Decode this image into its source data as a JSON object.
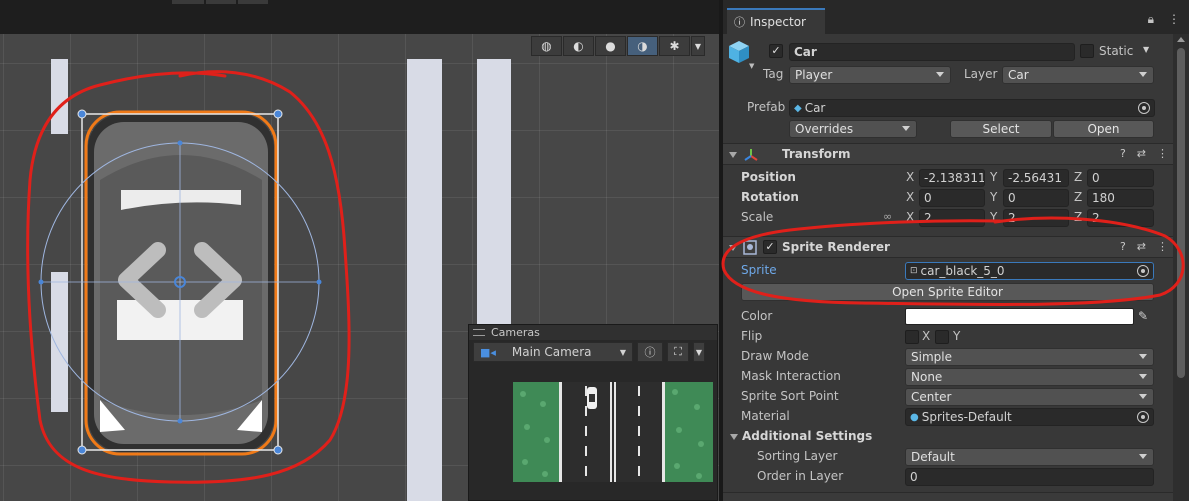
{
  "scene": {
    "draw_tools": [
      {
        "icon": "wireframe-globe-icon",
        "glyph": "◍"
      },
      {
        "icon": "shaded-wireframe-icon",
        "glyph": "◐"
      },
      {
        "icon": "shaded-sphere-icon",
        "glyph": "●"
      },
      {
        "icon": "unlit-moon-icon",
        "glyph": "◑"
      },
      {
        "icon": "debug-bug-icon",
        "glyph": "✱"
      }
    ]
  },
  "cameras": {
    "title": "Cameras",
    "selected": "Main Camera"
  },
  "inspector": {
    "tab_label": "Inspector",
    "object": {
      "name": "Car",
      "active": "✓",
      "static_label": "Static",
      "tag_label": "Tag",
      "tag_value": "Player",
      "layer_label": "Layer",
      "layer_value": "Car",
      "prefab_label": "Prefab",
      "prefab_value": "Car",
      "overrides_label": "Overrides",
      "select_label": "Select",
      "open_label": "Open"
    },
    "transform": {
      "title": "Transform",
      "position_label": "Position",
      "rotation_label": "Rotation",
      "scale_label": "Scale",
      "axis_x": "X",
      "axis_y": "Y",
      "axis_z": "Z",
      "position": {
        "x": "-2.138311",
        "y": "-2.56431",
        "z": "0"
      },
      "rotation": {
        "x": "0",
        "y": "0",
        "z": "180"
      },
      "scale": {
        "x": "2",
        "y": "2",
        "z": "2"
      }
    },
    "sprite_renderer": {
      "title": "Sprite Renderer",
      "enabled": "✓",
      "sprite_label": "Sprite",
      "sprite_value": "car_black_5_0",
      "open_editor_label": "Open Sprite Editor",
      "color_label": "Color",
      "color_value": "#ffffff",
      "flip_label": "Flip",
      "flip_x": "X",
      "flip_y": "Y",
      "draw_mode_label": "Draw Mode",
      "draw_mode_value": "Simple",
      "mask_label": "Mask Interaction",
      "mask_value": "None",
      "sort_point_label": "Sprite Sort Point",
      "sort_point_value": "Center",
      "material_label": "Material",
      "material_value": "Sprites-Default",
      "additional_label": "Additional Settings",
      "sorting_layer_label": "Sorting Layer",
      "sorting_layer_value": "Default",
      "order_label": "Order in Layer",
      "order_value": "0"
    }
  },
  "colors": {
    "accent": "#3a79bb",
    "annotation_red": "#e0201a",
    "selection_orange": "#f07a18",
    "gizmo_blue": "#4a86d8"
  }
}
